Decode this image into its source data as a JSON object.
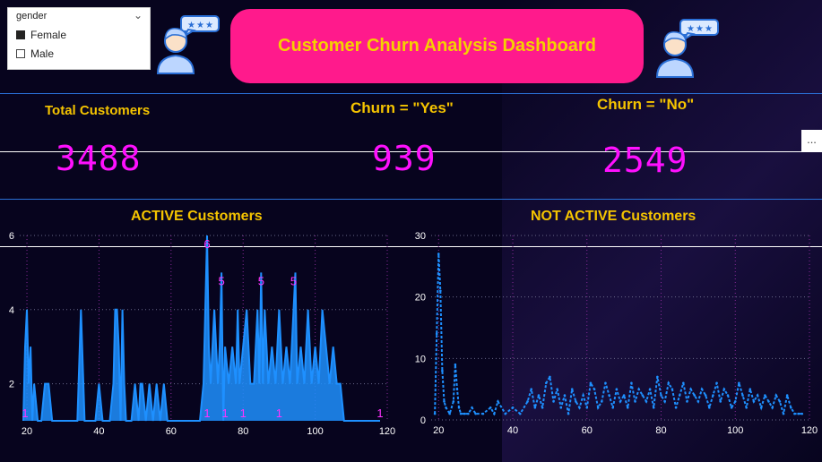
{
  "slicer": {
    "title": "gender",
    "options": [
      {
        "label": "Female",
        "checked": true
      },
      {
        "label": "Male",
        "checked": false
      }
    ]
  },
  "header": {
    "title": "Customer Churn Analysis Dashboard"
  },
  "kpis": [
    {
      "label": "Total Customers",
      "value": "3488"
    },
    {
      "label": "Churn = \"Yes\"",
      "value": "939"
    },
    {
      "label": "Churn = \"No\"",
      "value": "2549"
    }
  ],
  "more_label": "...",
  "colors": {
    "background": "#07041e",
    "banner": "#ff1a8c",
    "title_text": "#f5d000",
    "kpi_value": "#ff10ff",
    "series": "#1e90ff",
    "divider": "#2a6fd6",
    "point_label": "#ff33ff"
  },
  "icons": [
    "customer-review-avatar-icon",
    "customer-review-avatar-icon",
    "more-options-icon",
    "chevron-down-icon"
  ],
  "chart_data": [
    {
      "type": "area",
      "title": "ACTIVE Customers",
      "xlim": [
        18,
        120
      ],
      "ylim": [
        1,
        6
      ],
      "xticks": [
        20,
        40,
        60,
        80,
        100,
        120
      ],
      "yticks": [
        2,
        4,
        6
      ],
      "grid": true,
      "x": [
        19,
        19.5,
        20,
        20.5,
        21,
        21.5,
        22,
        23,
        24,
        25,
        26,
        27,
        28,
        29,
        30,
        31,
        32,
        33,
        34,
        35,
        36,
        37,
        38,
        39,
        40,
        41,
        42,
        43,
        44,
        44.5,
        45,
        45.5,
        46,
        46.5,
        47,
        47.5,
        48,
        49,
        50,
        51,
        51.5,
        52,
        53,
        54,
        55,
        56,
        57,
        58,
        59,
        60,
        61,
        62,
        63,
        64,
        65,
        66,
        67,
        68,
        69,
        69.5,
        70,
        70.5,
        71,
        72,
        73,
        73.5,
        74,
        74.5,
        75,
        76,
        77,
        78,
        78.5,
        79,
        80,
        81,
        82,
        83,
        84,
        84.5,
        85,
        85.5,
        86,
        87,
        88,
        89,
        90,
        91,
        92,
        93,
        93.5,
        94,
        94.5,
        95,
        96,
        97,
        98,
        99,
        100,
        101,
        102,
        103,
        104,
        105,
        106,
        107,
        108,
        110,
        112,
        114,
        116,
        118
      ],
      "values": [
        1,
        3,
        4,
        2,
        3,
        1,
        2,
        1,
        1,
        2,
        2,
        1,
        1,
        1,
        1,
        1,
        1,
        1,
        1,
        4,
        1,
        1,
        1,
        1,
        2,
        1,
        1,
        1,
        2,
        4,
        4,
        3,
        1,
        4,
        2,
        1,
        1,
        1,
        2,
        1,
        2,
        2,
        1,
        2,
        1,
        2,
        1,
        2,
        1,
        1,
        1,
        1,
        1,
        1,
        1,
        1,
        1,
        1,
        2,
        4,
        6,
        3,
        2,
        4,
        2,
        3,
        5,
        1,
        3,
        2,
        3,
        2,
        4,
        2,
        3,
        4,
        2,
        2,
        4,
        2,
        5,
        2,
        4,
        2,
        3,
        2,
        4,
        2,
        3,
        2,
        3,
        4,
        5,
        2,
        3,
        2,
        4,
        2,
        3,
        2,
        4,
        3,
        2,
        3,
        2,
        2,
        1,
        1,
        1,
        1,
        1,
        1,
        1
      ],
      "point_labels": [
        {
          "x": 19.5,
          "y": 1,
          "label": "1"
        },
        {
          "x": 70,
          "y": 6,
          "label": "6"
        },
        {
          "x": 70,
          "y": 1,
          "label": "1"
        },
        {
          "x": 74,
          "y": 5,
          "label": "5"
        },
        {
          "x": 75,
          "y": 1,
          "label": "1"
        },
        {
          "x": 80,
          "y": 1,
          "label": "1"
        },
        {
          "x": 85,
          "y": 5,
          "label": "5"
        },
        {
          "x": 90,
          "y": 1,
          "label": "1"
        },
        {
          "x": 94,
          "y": 5,
          "label": "5"
        },
        {
          "x": 118,
          "y": 1,
          "label": "1"
        }
      ]
    },
    {
      "type": "line",
      "title": "NOT ACTIVE Customers",
      "xlim": [
        18,
        120
      ],
      "ylim": [
        0,
        30
      ],
      "xticks": [
        20,
        40,
        60,
        80,
        100,
        120
      ],
      "yticks": [
        0,
        10,
        20,
        30
      ],
      "grid": true,
      "x": [
        19,
        19.5,
        20,
        20.5,
        21,
        21.5,
        22,
        23,
        24,
        24.5,
        25,
        25.5,
        26,
        27,
        28,
        29,
        30,
        32,
        34,
        35,
        36,
        38,
        40,
        42,
        44,
        45,
        46,
        47,
        48,
        49,
        50,
        51,
        52,
        53,
        54,
        55,
        56,
        57,
        58,
        59,
        60,
        61,
        62,
        63,
        64,
        65,
        66,
        67,
        68,
        69,
        70,
        71,
        72,
        73,
        74,
        75,
        76,
        77,
        78,
        79,
        80,
        81,
        82,
        83,
        84,
        85,
        86,
        87,
        88,
        89,
        90,
        91,
        92,
        93,
        94,
        95,
        96,
        97,
        98,
        99,
        100,
        101,
        102,
        103,
        104,
        105,
        106,
        107,
        108,
        109,
        110,
        111,
        112,
        113,
        114,
        115,
        116,
        117,
        118
      ],
      "values": [
        1,
        14,
        27,
        21,
        8,
        3,
        2,
        1,
        3,
        9,
        5,
        2,
        1,
        1,
        1,
        2,
        1,
        1,
        2,
        1,
        3,
        1,
        2,
        1,
        3,
        5,
        2,
        4,
        2,
        6,
        7,
        3,
        5,
        2,
        4,
        1,
        5,
        3,
        2,
        4,
        2,
        6,
        5,
        2,
        3,
        6,
        4,
        2,
        5,
        3,
        4,
        2,
        6,
        3,
        5,
        4,
        3,
        5,
        2,
        7,
        4,
        3,
        6,
        5,
        2,
        4,
        6,
        3,
        5,
        4,
        3,
        5,
        4,
        2,
        4,
        6,
        3,
        5,
        4,
        2,
        3,
        6,
        4,
        2,
        5,
        3,
        4,
        2,
        4,
        3,
        2,
        4,
        3,
        1,
        4,
        2,
        1,
        1,
        1
      ]
    }
  ]
}
